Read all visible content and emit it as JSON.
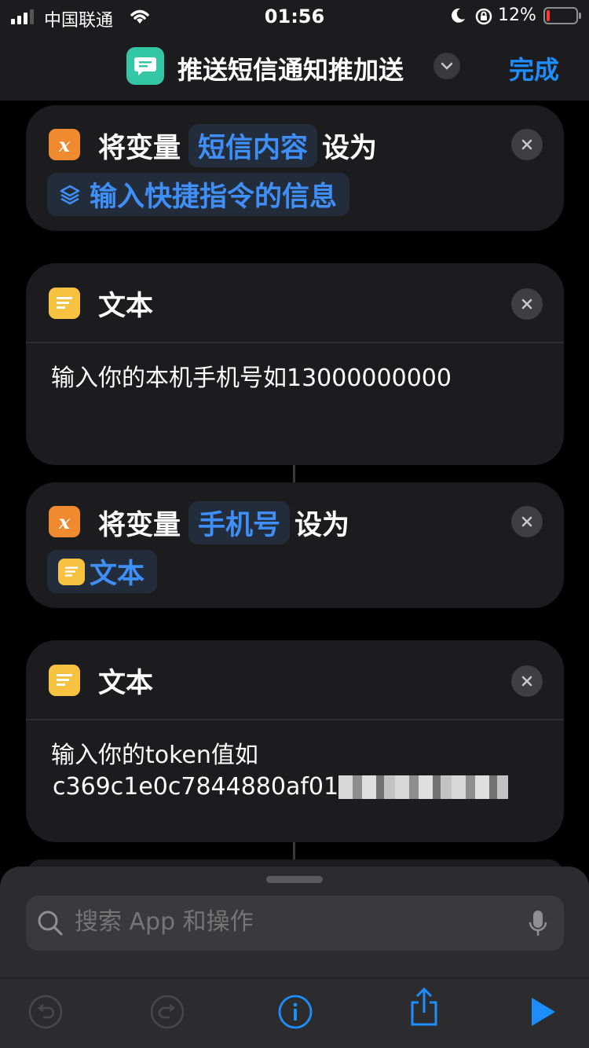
{
  "status": {
    "carrier": "中国联通",
    "time": "01:56",
    "battery_pct": "12%",
    "battery_level": 0.12,
    "battery_color": "#ff3b30"
  },
  "nav": {
    "title": "推送短信通知推加送",
    "done_label": "完成",
    "app_icon": "message-icon",
    "accent": "#1e8eff"
  },
  "cards": [
    {
      "type": "set-variable",
      "prefix": "将变量",
      "variable": "短信内容",
      "suffix": "设为",
      "value": "输入快捷指令的信息",
      "value_icon": "shortcut-input-icon"
    },
    {
      "type": "text",
      "title": "文本",
      "body": "输入你的本机手机号如13000000000"
    },
    {
      "type": "set-variable",
      "prefix": "将变量",
      "variable": "手机号",
      "suffix": "设为",
      "value": "文本",
      "value_icon": "text-icon"
    },
    {
      "type": "text",
      "title": "文本",
      "body_line1": "输入你的token值如",
      "body_line2": "c369c1e0c7844880af01"
    }
  ],
  "search": {
    "placeholder": "搜索 App 和操作"
  },
  "toolbar": {
    "icons": [
      "undo-icon",
      "redo-icon",
      "info-icon",
      "share-icon",
      "play-icon"
    ]
  }
}
